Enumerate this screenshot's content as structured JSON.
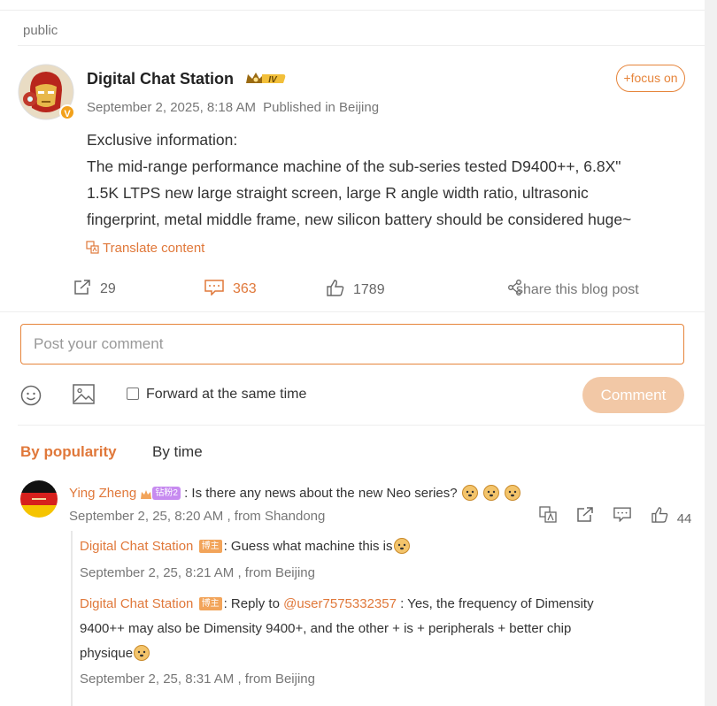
{
  "visibility": "public",
  "post": {
    "author": "Digital Chat Station",
    "level_badge": "IV",
    "verified_badge": "V",
    "follow_label": "+focus on",
    "date": "September 2, 2025, 8:18 AM",
    "location": "Published in Beijing",
    "text_lines": [
      "Exclusive information:",
      "The mid-range performance machine of the sub-series tested D9400++, 6.8X\"",
      "1.5K LTPS new large straight screen, large R angle width ratio, ultrasonic",
      "fingerprint, metal middle frame, new silicon battery should be considered huge~"
    ],
    "translate_label": "Translate content",
    "stats": {
      "reposts": "29",
      "comments": "363",
      "likes": "1789",
      "share_label": "share this blog post"
    }
  },
  "composer": {
    "placeholder": "Post your comment",
    "forward_label": "Forward at the same time",
    "submit_label": "Comment"
  },
  "sort_tabs": [
    "By popularity",
    "By time"
  ],
  "comments": [
    {
      "user": "Ying Zheng",
      "fan_badge": "钻粉2",
      "text": ": Is there any news about the new Neo series?",
      "meta": "September 2, 25, 8:20 AM , from Shandong",
      "likes": "44",
      "replies": [
        {
          "user": "Digital Chat Station",
          "host_badge": "博主",
          "text": ": Guess what machine this is",
          "meta": "September 2, 25, 8:21 AM , from Beijing"
        },
        {
          "user": "Digital Chat Station",
          "host_badge": "博主",
          "prefix": ": Reply to ",
          "mention": "@user7575332357",
          "text_line1": " : Yes, the frequency of Dimensity",
          "text_line2": "9400++ may also be Dimensity 9400+, and the other + is + peripherals + better chip",
          "text_line3": "physique",
          "meta": "September 2, 25, 8:31 AM , from Beijing"
        }
      ]
    }
  ],
  "colors": {
    "accent": "#e0783a",
    "comment_button": "#f2c8a6",
    "badge_fan": "#c78bf0",
    "badge_host": "#f2a45a"
  }
}
